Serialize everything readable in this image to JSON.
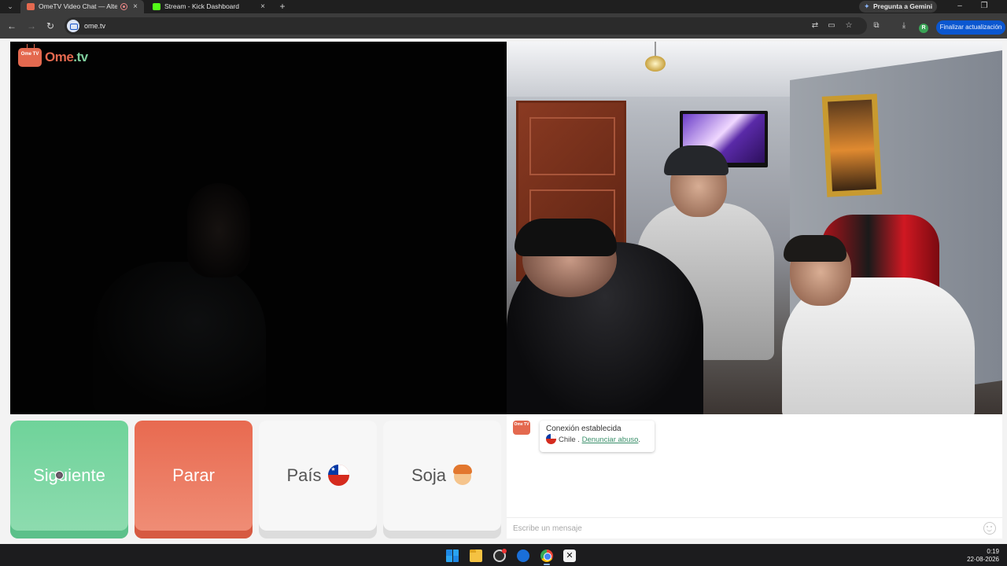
{
  "browser": {
    "tabs": [
      {
        "title": "OmeTV Video Chat — Alte",
        "active": true
      },
      {
        "title": "Stream - Kick Dashboard",
        "active": false
      }
    ],
    "new_tab": "+",
    "gemini_label": "Pregunta a Gemini",
    "url": "ome.tv",
    "update_label": "Finalizar actualización",
    "profile_initial": "R"
  },
  "ometv": {
    "logo": {
      "tv_text": "Ome TV",
      "word_a": "Ome",
      "word_b": ".tv"
    },
    "controls": {
      "next_label": "Siguiente",
      "stop_label": "Parar",
      "country_label": "País",
      "gender_label": "Soja"
    },
    "chat": {
      "avatar_text": "Ome TV",
      "status_title": "Conexión establecida",
      "country": "Chile",
      "separator": ".",
      "report_link": "Denunciar abuso",
      "report_suffix": ".",
      "input_placeholder": "Escribe un mensaje"
    },
    "colors": {
      "next": "#6fd39a",
      "stop": "#e86a50",
      "brand": "#e4694f"
    }
  },
  "taskbar": {
    "time": "0:19",
    "date": "22-08-2026"
  },
  "icons": [
    "chevron-down-icon",
    "record-icon",
    "close-icon",
    "kick-icon",
    "sparkle-icon",
    "minimize-icon",
    "restore-icon",
    "back-icon",
    "forward-icon",
    "reload-icon",
    "site-info-icon",
    "translate-icon",
    "cast-icon",
    "star-icon",
    "extensions-icon",
    "download-icon",
    "chile-flag-icon",
    "boy-face-icon",
    "emoji-icon",
    "windows-start-icon",
    "file-explorer-icon",
    "obs-icon",
    "chrome-icon",
    "capcut-icon"
  ]
}
